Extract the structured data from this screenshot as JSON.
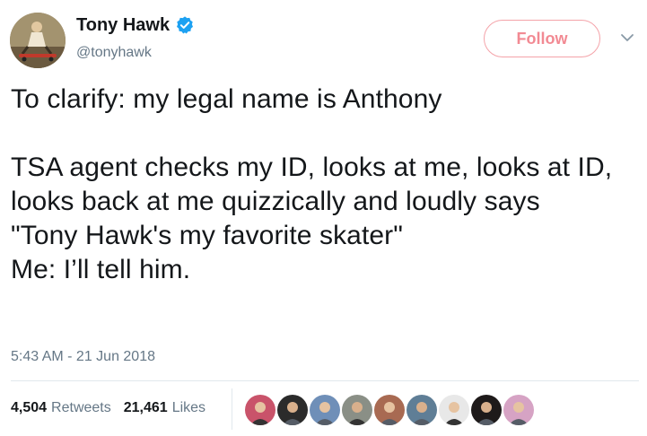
{
  "user": {
    "display_name": "Tony Hawk",
    "handle": "@tonyhawk",
    "verified_icon": "verified-badge-icon"
  },
  "header": {
    "follow_label": "Follow",
    "more_icon": "chevron-down-icon"
  },
  "tweet": {
    "paragraphs": [
      "To clarify: my legal name is Anthony",
      "",
      "TSA agent checks my ID, looks at me, looks at ID, looks back at me quizzically and loudly says",
      "\"Tony Hawk's my favorite skater\"",
      "Me: I’ll tell him."
    ],
    "timestamp": "5:43 AM - 21 Jun 2018"
  },
  "stats": {
    "retweets_count": "4,504",
    "retweets_label": "Retweets",
    "likes_count": "21,461",
    "likes_label": "Likes"
  },
  "likers": [
    {
      "name": "liker-avatar-1",
      "color": "#c9536a"
    },
    {
      "name": "liker-avatar-2",
      "color": "#2b2b2b"
    },
    {
      "name": "liker-avatar-3",
      "color": "#6f8fb8"
    },
    {
      "name": "liker-avatar-4",
      "color": "#8a8f86"
    },
    {
      "name": "liker-avatar-5",
      "color": "#a86a52"
    },
    {
      "name": "liker-avatar-6",
      "color": "#5f7e96"
    },
    {
      "name": "liker-avatar-7",
      "color": "#e8e8e8"
    },
    {
      "name": "liker-avatar-8",
      "color": "#1e1a1a"
    },
    {
      "name": "liker-avatar-9",
      "color": "#d6a3c4"
    }
  ],
  "colors": {
    "follow_accent": "#f28a93",
    "verified_blue": "#1da1f2",
    "secondary_text": "#657786"
  }
}
